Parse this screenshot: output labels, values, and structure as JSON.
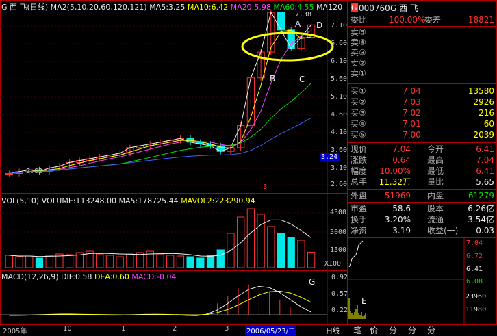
{
  "main_chart": {
    "title_name": "G 西  飞",
    "period": "(日线)",
    "ma_header": "MA2(5,10,20,60,120,121)",
    "ma5": "MA5:3.25",
    "ma10": "MA10:6.42",
    "ma20": "MA20:5.98",
    "ma60": "MA60:4.55",
    "ma120": "MA120",
    "high_label": "7.38",
    "low_label": "2.62",
    "current_price_tag": "3.24",
    "annotations": [
      "A",
      "B",
      "C",
      "D"
    ],
    "y_ticks": [
      "7.10",
      "6.60",
      "6.10",
      "5.60",
      "5.10",
      "4.60",
      "4.10",
      "3.60",
      "3.24",
      "3.10",
      "2.60"
    ],
    "marker": "3"
  },
  "volume_chart": {
    "header_vol": "VOL(5,10)",
    "header_volume": "VOLUME:113248.00",
    "header_ma5": "MA5:178725.44",
    "header_mavol2": "MAVOL2:223290.94",
    "y_ticks": [
      "4300",
      "3000",
      "1300"
    ],
    "unit": "X100"
  },
  "macd_chart": {
    "header": "MACD(12,26,9)",
    "dif": "DIF:0.58",
    "dea": "DEA:0.60",
    "macd": "MACD:-0.04",
    "annotation": "G",
    "y_ticks": [
      "0.92",
      "0.57",
      "0.22"
    ]
  },
  "time_axis": {
    "labels": [
      "2005年",
      "10",
      "1",
      "2",
      "3"
    ],
    "cursor_date": "2006/05/23/二",
    "right_tab": "日线"
  },
  "quote_panel": {
    "code_badge": "G",
    "code": "000760",
    "name": "G 西  飞",
    "weibi_label": "委比",
    "weibi_value": "100.00%",
    "weicha_label": "委差",
    "weicha_value": "18821",
    "sell": [
      {
        "label": "卖⑤",
        "price": "",
        "vol": ""
      },
      {
        "label": "卖④",
        "price": "",
        "vol": ""
      },
      {
        "label": "卖③",
        "price": "",
        "vol": ""
      },
      {
        "label": "卖②",
        "price": "",
        "vol": ""
      },
      {
        "label": "卖①",
        "price": "",
        "vol": ""
      }
    ],
    "buy": [
      {
        "label": "买①",
        "price": "7.04",
        "vol": "13580"
      },
      {
        "label": "买②",
        "price": "7.03",
        "vol": "2926"
      },
      {
        "label": "买③",
        "price": "7.02",
        "vol": "216"
      },
      {
        "label": "买④",
        "price": "7.01",
        "vol": "60"
      },
      {
        "label": "买⑤",
        "price": "7.00",
        "vol": "2039"
      }
    ],
    "stats": [
      {
        "l1": "现价",
        "v1": "7.04",
        "l2": "今开",
        "v2": "6.41"
      },
      {
        "l1": "涨跌",
        "v1": "0.64",
        "l2": "最高",
        "v2": "7.04"
      },
      {
        "l1": "幅度",
        "v1": "10.00%",
        "l2": "最低",
        "v2": "6.41"
      },
      {
        "l1": "总手",
        "v1": "11.32万",
        "l2": "量比",
        "v2": "5.65"
      },
      {
        "l1": "外盘",
        "v1": "51969",
        "l2": "内盘",
        "v2": "61279"
      },
      {
        "l1": "市盈",
        "v1": "58.6",
        "l2": "股本",
        "v2": "6.26亿"
      },
      {
        "l1": "换手",
        "v1": "3.20%",
        "l2": "流通",
        "v2": "3.54亿"
      },
      {
        "l1": "净资",
        "v1": "3.19",
        "l2": "收益(一)",
        "v2": "0.03"
      }
    ],
    "mini_ticks": [
      "7.04",
      "6.72",
      "6.41",
      "6.08",
      "23960",
      "11980"
    ],
    "mini_label": "E",
    "tabs": [
      "笔",
      "价",
      "分",
      "分",
      "分"
    ]
  },
  "chart_data": [
    {
      "type": "line",
      "title": "G 西飞 日线",
      "ylim": [
        2.6,
        7.38
      ],
      "series": [
        {
          "name": "Price (approx. closes)",
          "values": [
            3.0,
            3.05,
            3.1,
            3.05,
            3.15,
            3.2,
            3.3,
            3.35,
            3.4,
            3.45,
            3.5,
            3.55,
            3.7,
            3.75,
            3.8,
            3.85,
            3.9,
            3.95,
            3.85,
            3.8,
            3.75,
            3.6,
            3.7,
            4.3,
            5.6,
            6.3,
            7.38,
            6.9,
            6.4,
            6.7,
            7.04
          ]
        }
      ]
    },
    {
      "type": "bar",
      "title": "VOL",
      "ylim": [
        0,
        4300
      ],
      "values": [
        900,
        800,
        850,
        700,
        900,
        1000,
        950,
        1100,
        1200,
        1000,
        900,
        800,
        1000,
        1100,
        1200,
        1000,
        900,
        850,
        800,
        700,
        900,
        1300,
        2500,
        3700,
        4300,
        3900,
        3000,
        2500,
        2200,
        2000,
        1132
      ]
    },
    {
      "type": "bar",
      "title": "MACD",
      "ylim": [
        -0.2,
        0.92
      ],
      "values": [
        -0.02,
        -0.01,
        0.0,
        0.01,
        0.02,
        0.02,
        0.01,
        0.0,
        -0.01,
        -0.02,
        -0.01,
        0.0,
        0.01,
        0.02,
        0.01,
        0.0,
        -0.02,
        -0.03,
        -0.02,
        0.1,
        0.3,
        0.5,
        0.7,
        0.8,
        0.75,
        0.6,
        0.4,
        0.2,
        0.05,
        -0.04
      ]
    }
  ]
}
